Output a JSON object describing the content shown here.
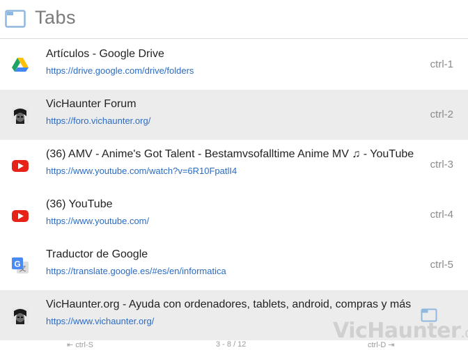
{
  "header": {
    "title": "Tabs",
    "icon": "tabs-window-icon"
  },
  "tabs": [
    {
      "title": "Artículos - Google Drive",
      "url": "https://drive.google.com/drive/folders",
      "shortcut": "ctrl-1",
      "favicon": "google-drive-icon"
    },
    {
      "title": "VicHaunter Forum",
      "url": "https://foro.vichaunter.org/",
      "shortcut": "ctrl-2",
      "favicon": "vichaunter-avatar-icon"
    },
    {
      "title": "(36) AMV - Anime's Got Talent - Bestamvsofalltime Anime MV ♫ - YouTube",
      "url": "https://www.youtube.com/watch?v=6R10FpatlI4",
      "shortcut": "ctrl-3",
      "favicon": "youtube-icon"
    },
    {
      "title": "(36) YouTube",
      "url": "https://www.youtube.com/",
      "shortcut": "ctrl-4",
      "favicon": "youtube-icon"
    },
    {
      "title": "Traductor de Google",
      "url": "https://translate.google.es/#es/en/informatica",
      "shortcut": "ctrl-5",
      "favicon": "google-translate-icon"
    },
    {
      "title": "VicHaunter.org - Ayuda con ordenadores, tablets, android, compras y más",
      "url": "https://www.vichaunter.org/",
      "shortcut": "",
      "favicon": "vichaunter-avatar-icon"
    }
  ],
  "footer": {
    "prev": "ctrl-S",
    "pager": "3 - 8 / 12",
    "next": "ctrl-D"
  },
  "watermark": {
    "main": "VicHaunter",
    "suffix": ".org"
  },
  "colors": {
    "url": "#2b6bc4",
    "selected_row": "#ececec",
    "shortcut": "#8a8a8a"
  }
}
